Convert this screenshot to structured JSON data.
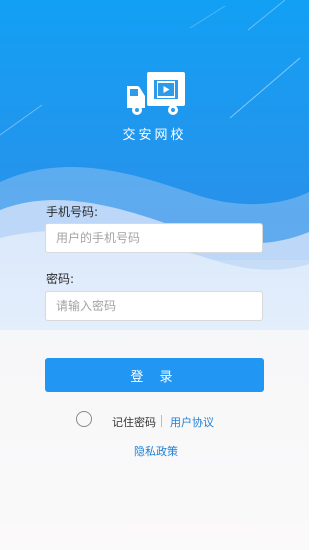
{
  "app": {
    "title": "交安网校"
  },
  "form": {
    "phone_label": "手机号码:",
    "phone_placeholder": "用户的手机号码",
    "password_label": "密码:",
    "password_placeholder": "请输入密码",
    "login_button": "登 录"
  },
  "footer": {
    "remember_label": "记住密码",
    "agreement_link": "用户协议",
    "privacy_link": "隐私政策"
  },
  "colors": {
    "header_blue": "#1a9ff0",
    "button_blue": "#2196f3",
    "link_blue": "#1e7fd6"
  }
}
